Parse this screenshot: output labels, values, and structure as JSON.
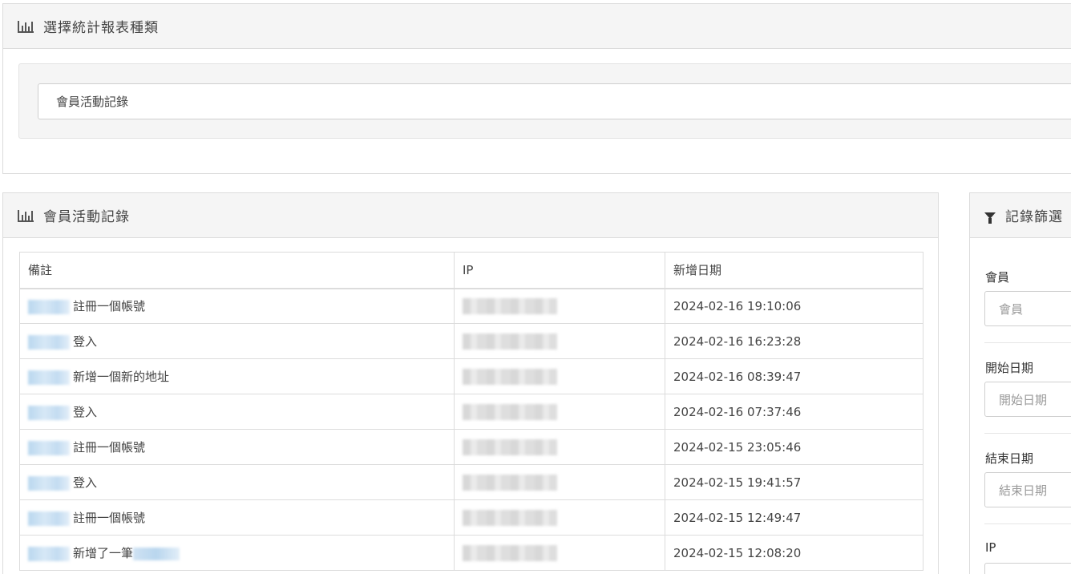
{
  "report_panel": {
    "title": "選擇統計報表種類",
    "icon": "bar-chart-icon",
    "selected_report": "會員活動記錄"
  },
  "log_panel": {
    "title": "會員活動記錄",
    "icon": "bar-chart-icon",
    "columns": [
      "備註",
      "IP",
      "新增日期"
    ],
    "rows": [
      {
        "note": "註冊一個帳號",
        "date": "2024-02-16 19:10:06"
      },
      {
        "note": "登入",
        "date": "2024-02-16 16:23:28"
      },
      {
        "note": "新增一個新的地址",
        "date": "2024-02-16 08:39:47"
      },
      {
        "note": "登入",
        "date": "2024-02-16 07:37:46"
      },
      {
        "note": "註冊一個帳號",
        "date": "2024-02-15 23:05:46"
      },
      {
        "note": "登入",
        "date": "2024-02-15 19:41:57"
      },
      {
        "note": "註冊一個帳號",
        "date": "2024-02-15 12:49:47"
      },
      {
        "note": "新增了一筆",
        "date": "2024-02-15 12:08:20"
      }
    ]
  },
  "filter_panel": {
    "title": "記錄篩選",
    "icon": "filter-icon",
    "member_label": "會員",
    "member_placeholder": "會員",
    "start_label": "開始日期",
    "start_placeholder": "開始日期",
    "end_label": "結束日期",
    "end_placeholder": "結束日期",
    "ip_label": "IP"
  }
}
